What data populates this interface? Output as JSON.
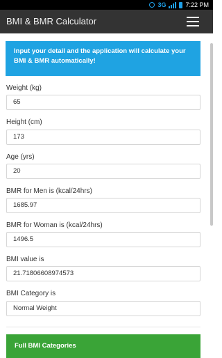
{
  "status_bar": {
    "network": "3G",
    "time": "7:22 PM",
    "icons": [
      "alarm-icon",
      "signal-icon",
      "battery-icon"
    ]
  },
  "app_bar": {
    "title": "BMI & BMR Calculator",
    "menu_icon": "hamburger-menu-icon"
  },
  "info_box": {
    "text": "Input your detail and the application will calculate your BMI & BMR automatically!"
  },
  "fields": [
    {
      "label": "Weight (kg)",
      "value": "65"
    },
    {
      "label": "Height (cm)",
      "value": "173"
    },
    {
      "label": "Age (yrs)",
      "value": "20"
    },
    {
      "label": "BMR for Men is (kcal/24hrs)",
      "value": "1685.97"
    },
    {
      "label": "BMR for Woman is (kcal/24hrs)",
      "value": "1496.5"
    },
    {
      "label": "BMI value is",
      "value": "21.71806608974573"
    },
    {
      "label": "BMI Category is",
      "value": "Normal Weight"
    }
  ],
  "categories_button": {
    "label": "Full BMI Categories"
  },
  "colors": {
    "app_bar": "#333333",
    "info_box": "#1fa3e2",
    "categories_button": "#3aa437",
    "status_accent": "#1fa0e8"
  }
}
